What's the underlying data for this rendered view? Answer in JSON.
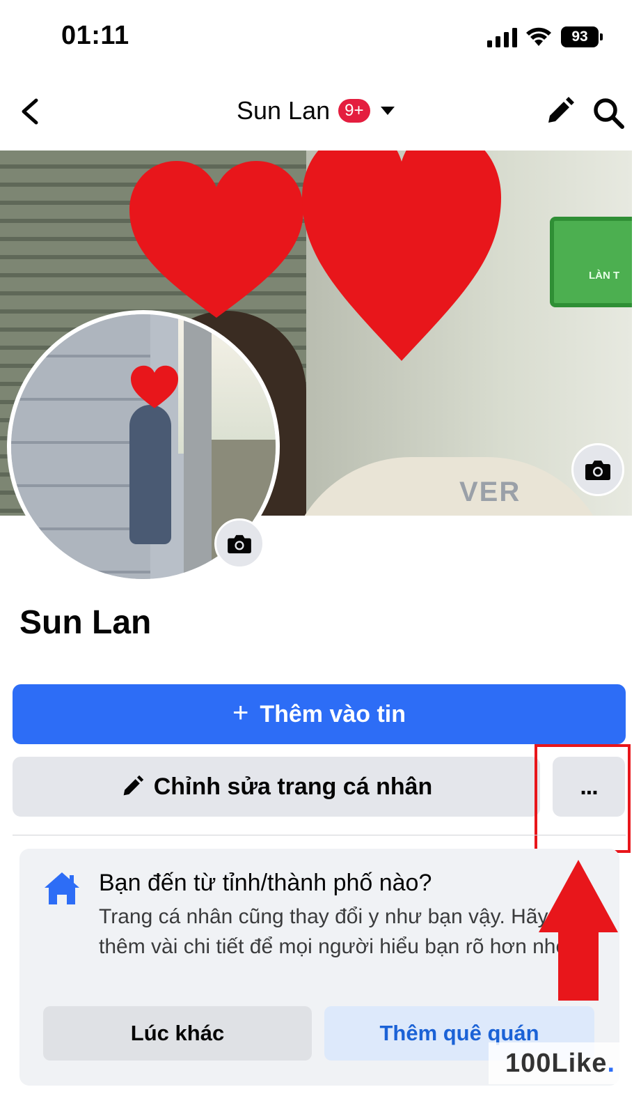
{
  "status_bar": {
    "time": "01:11",
    "battery": "93"
  },
  "header": {
    "title": "Sun Lan",
    "badge": "9+"
  },
  "cover": {
    "sign_text": "LÀN T",
    "shirt_text": "VER"
  },
  "profile": {
    "name": "Sun Lan"
  },
  "actions": {
    "add_story_label": "Thêm vào tin",
    "add_story_plus": "+",
    "edit_profile_label": "Chỉnh sửa trang cá nhân",
    "more_label": "..."
  },
  "hometown_card": {
    "title": "Bạn đến từ tỉnh/thành phố nào?",
    "description": "Trang cá nhân cũng thay đổi y như bạn vậy. Hãy thêm vài chi tiết để mọi người hiểu bạn rõ hơn nhé.",
    "later_label": "Lúc khác",
    "add_hometown_label": "Thêm quê quán"
  },
  "watermark": {
    "text": "100Like",
    "dot": "."
  },
  "colors": {
    "primary": "#2d6df6",
    "badge": "#e41e3f",
    "annotation": "#e8161b",
    "secondary_button": "#e4e6eb"
  },
  "icons": [
    "back-icon",
    "caret-down-icon",
    "pencil-icon",
    "search-icon",
    "camera-icon",
    "plus-icon",
    "home-icon",
    "more-icon"
  ]
}
